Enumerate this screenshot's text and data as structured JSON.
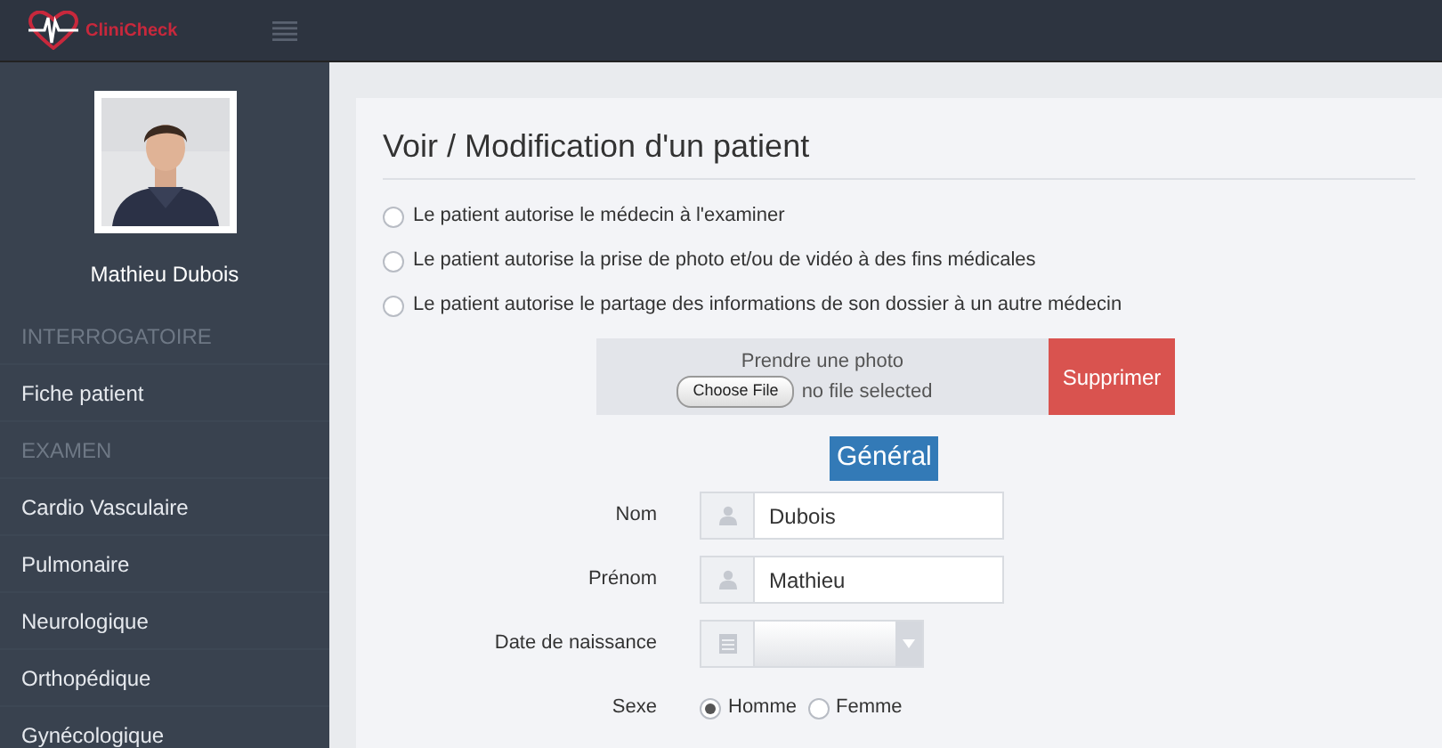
{
  "header": {
    "logo_text": "CliniCheck"
  },
  "sidebar": {
    "patient_name": "Mathieu Dubois",
    "items": [
      {
        "kind": "header",
        "label": "INTERROGATOIRE"
      },
      {
        "kind": "link",
        "label": "Fiche patient"
      },
      {
        "kind": "header",
        "label": "EXAMEN"
      },
      {
        "kind": "link",
        "label": "Cardio Vasculaire"
      },
      {
        "kind": "link",
        "label": "Pulmonaire"
      },
      {
        "kind": "link",
        "label": "Neurologique"
      },
      {
        "kind": "link",
        "label": "Orthopédique"
      },
      {
        "kind": "link",
        "label": "Gynécologique"
      }
    ]
  },
  "main": {
    "title": "Voir / Modification d'un patient",
    "consents": [
      {
        "label": "Le patient autorise le médecin à l'examiner",
        "checked": false
      },
      {
        "label": "Le patient autorise la prise de photo et/ou de vidéo à des fins médicales",
        "checked": false
      },
      {
        "label": "Le patient autorise le partage des informations de son dossier à un autre médecin",
        "checked": false
      }
    ],
    "photo_upload": {
      "label": "Prendre une photo",
      "button": "Choose File",
      "status": "no file selected",
      "delete_button": "Supprimer"
    },
    "section": "Général",
    "fields": [
      {
        "kind": "text",
        "label": "Nom",
        "value": "Dubois"
      },
      {
        "kind": "text",
        "label": "Prénom",
        "value": "Mathieu"
      },
      {
        "kind": "select",
        "label": "Date de naissance"
      },
      {
        "kind": "radio",
        "label": "Sexe",
        "options": [
          {
            "label": "Homme",
            "selected": true
          },
          {
            "label": "Femme",
            "selected": false
          }
        ]
      }
    ]
  }
}
